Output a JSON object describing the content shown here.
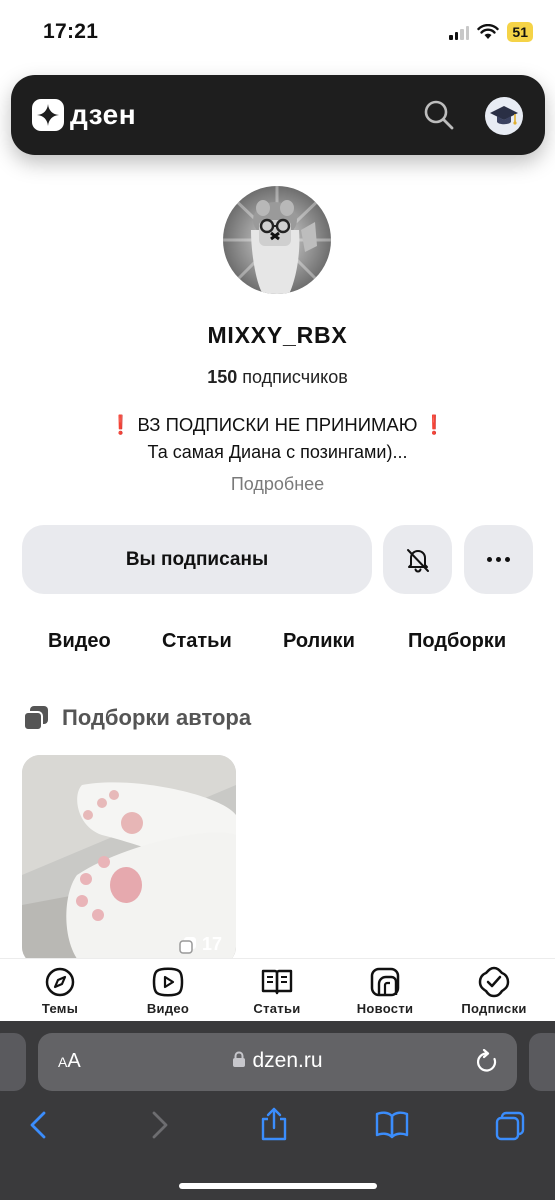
{
  "status_bar": {
    "time": "17:21",
    "battery": "51"
  },
  "header": {
    "logo_text": "дзен"
  },
  "profile": {
    "name": "MIXXY_RBX",
    "subscribers_count": "150",
    "subscribers_label": "подписчиков",
    "bio_line1": "ВЗ ПОДПИСКИ НЕ ПРИНИМАЮ",
    "bio_mark": "❗",
    "bio_line2": "Та самая Диана с позингами)...",
    "more_label": "Подробнее"
  },
  "actions": {
    "subscribed_label": "Вы подписаны"
  },
  "tabs": [
    "Видео",
    "Статьи",
    "Ролики",
    "Подборки"
  ],
  "collections": {
    "title": "Подборки автора",
    "card_count": "17"
  },
  "bottom_nav": [
    {
      "label": "Темы",
      "icon": "compass-icon"
    },
    {
      "label": "Видео",
      "icon": "video-play-icon"
    },
    {
      "label": "Статьи",
      "icon": "book-icon"
    },
    {
      "label": "Новости",
      "icon": "news-icon"
    },
    {
      "label": "Подписки",
      "icon": "subscriptions-icon"
    }
  ],
  "browser": {
    "aa_label_small": "A",
    "aa_label_big": "A",
    "url": "dzen.ru"
  }
}
